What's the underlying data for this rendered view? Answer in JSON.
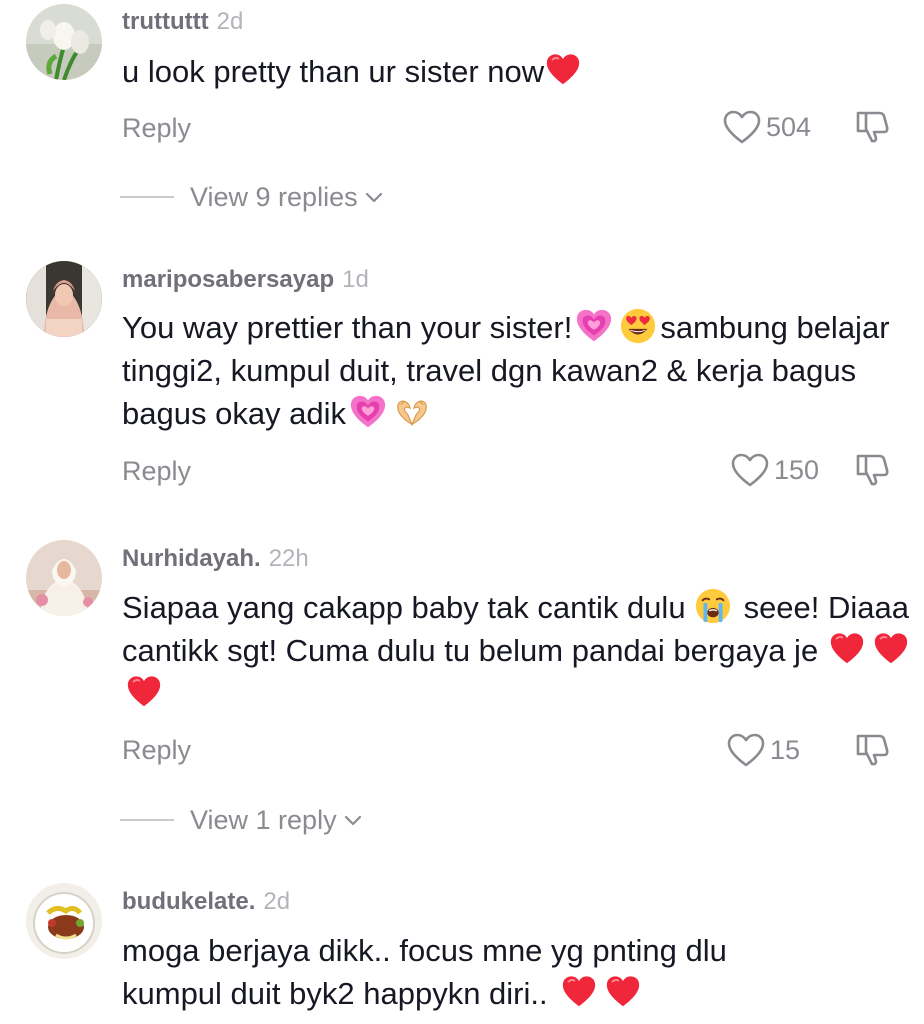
{
  "comments": [
    {
      "username": "truttuttt",
      "time": "2d",
      "text": "u look pretty than ur sister now",
      "emojis": [
        "red-heart"
      ],
      "reply_label": "Reply",
      "likes": "504",
      "view_replies": "View 9 replies"
    },
    {
      "username": "mariposabersayap",
      "time": "1d",
      "text_parts": [
        "You way prettier than your sister!",
        "sambung belajar tinggi2, kumpul duit, travel dgn kawan2 & kerja bagus bagus okay adik"
      ],
      "emojis": [
        "growing-heart",
        "heart-eyes",
        "growing-heart",
        "heart-hands"
      ],
      "reply_label": "Reply",
      "likes": "150"
    },
    {
      "username": "Nurhidayah.",
      "time": "22h",
      "text_parts": [
        "Siapaa yang cakapp baby tak cantik dulu",
        "seee! Diaaa cantikk sgt! Cuma dulu tu belum pandai bergaya je"
      ],
      "emojis": [
        "crying-face",
        "red-heart",
        "red-heart",
        "red-heart"
      ],
      "reply_label": "Reply",
      "likes": "15",
      "view_replies": "View 1 reply"
    },
    {
      "username": "budukelate.",
      "time": "2d",
      "text_parts": [
        "moga berjaya dikk.. focus mne yg pnting dlu kumpul duit byk2 happykn diri.."
      ],
      "emojis": [
        "red-heart",
        "red-heart"
      ]
    }
  ],
  "icons": {
    "like": "heart-outline-icon",
    "dislike": "thumbs-down-icon",
    "expand": "chevron-down-icon"
  },
  "colors": {
    "username": "#6f7079",
    "secondary": "#8a8b91",
    "timestamp": "#b3b4b9",
    "text": "#161823"
  }
}
